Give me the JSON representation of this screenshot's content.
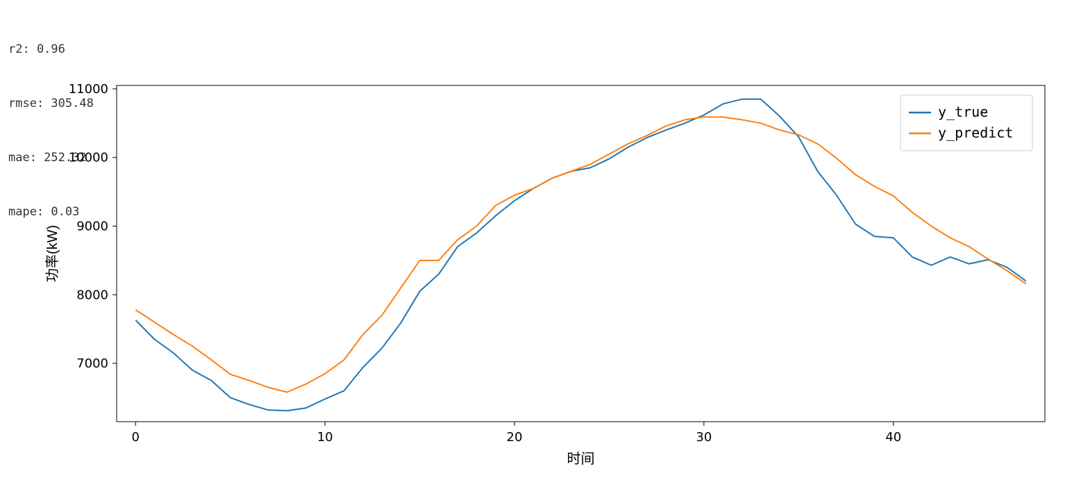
{
  "metrics": {
    "r2_label": "r2: 0.96",
    "rmse_label": "rmse: 305.48",
    "mae_label": "mae: 252.32",
    "mape_label": "mape: 0.03"
  },
  "chart_data": {
    "type": "line",
    "xlabel": "时间",
    "ylabel": "功率(kW)",
    "xlim": [
      -1,
      48
    ],
    "ylim": [
      6150,
      11050
    ],
    "xticks": [
      0,
      10,
      20,
      30,
      40
    ],
    "yticks": [
      7000,
      8000,
      9000,
      10000,
      11000
    ],
    "legend_position": "upper-right",
    "x": [
      0,
      1,
      2,
      3,
      4,
      5,
      6,
      7,
      8,
      9,
      10,
      11,
      12,
      13,
      14,
      15,
      16,
      17,
      18,
      19,
      20,
      21,
      22,
      23,
      24,
      25,
      26,
      27,
      28,
      29,
      30,
      31,
      32,
      33,
      34,
      35,
      36,
      37,
      38,
      39,
      40,
      41,
      42,
      43,
      44,
      45,
      46,
      47
    ],
    "series": [
      {
        "name": "y_true",
        "color": "#1f77b4",
        "values": [
          7630,
          7350,
          7150,
          6900,
          6750,
          6500,
          6400,
          6320,
          6310,
          6350,
          6480,
          6600,
          6940,
          7220,
          7590,
          8050,
          8300,
          8700,
          8900,
          9150,
          9370,
          9550,
          9700,
          9800,
          9850,
          9980,
          10150,
          10290,
          10400,
          10500,
          10620,
          10780,
          10850,
          10850,
          10600,
          10300,
          9800,
          9450,
          9030,
          8850,
          8830,
          8550,
          8430,
          8550,
          8450,
          8510,
          8400,
          8200
        ]
      },
      {
        "name": "y_predict",
        "color": "#ff7f0e",
        "values": [
          7780,
          7600,
          7420,
          7250,
          7050,
          6840,
          6750,
          6650,
          6580,
          6700,
          6850,
          7050,
          7420,
          7700,
          8100,
          8500,
          8500,
          8800,
          9000,
          9300,
          9450,
          9550,
          9700,
          9800,
          9900,
          10050,
          10200,
          10320,
          10460,
          10550,
          10590,
          10590,
          10550,
          10500,
          10400,
          10330,
          10200,
          9990,
          9750,
          9580,
          9440,
          9200,
          9000,
          8830,
          8700,
          8520,
          8350,
          8160
        ]
      }
    ]
  }
}
